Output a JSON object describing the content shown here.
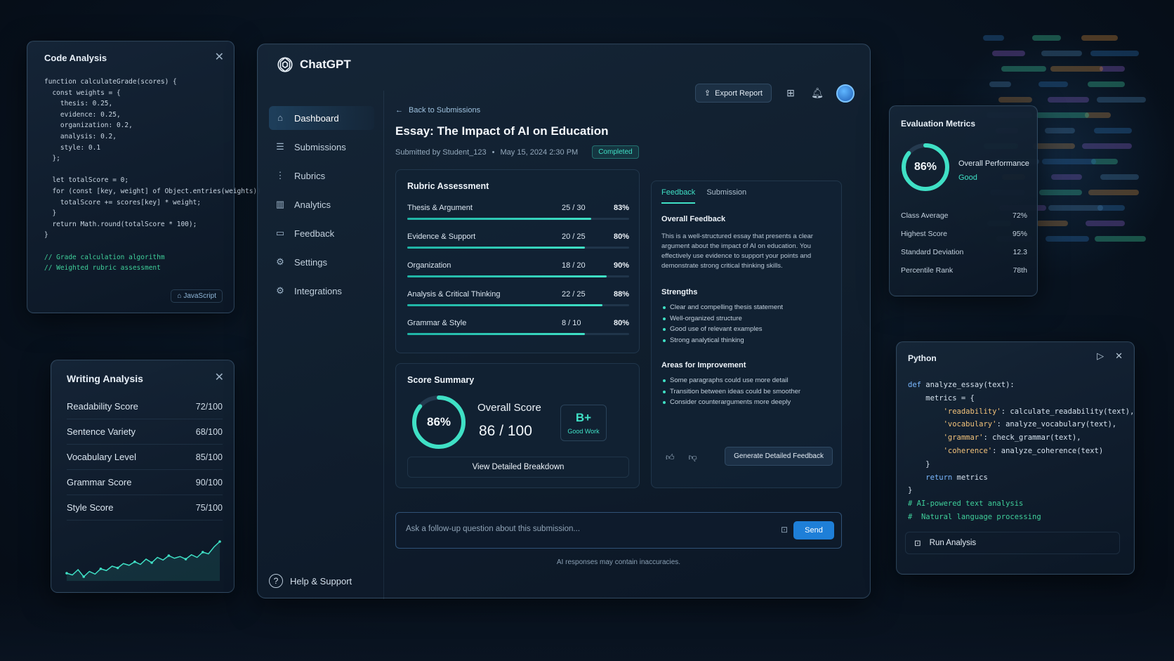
{
  "app": {
    "name": "ChatGPT"
  },
  "code_panel": {
    "title": "Code Analysis",
    "lines": [
      "function calculateGrade(scores) {",
      "  const weights = {",
      "    thesis: 0.25,",
      "    evidence: 0.25,",
      "    organization: 0.2,",
      "    analysis: 0.2,",
      "    style: 0.1",
      "  };",
      "",
      "  let totalScore = 0;",
      "  for (const [key, weight] of Object.entries(weights))",
      "    totalScore += scores[key] * weight;",
      "  }",
      "  return Math.round(totalScore * 100);",
      "}",
      "",
      "// Grade calculation algorithm",
      "// Weighted rubric assessment"
    ],
    "language": "JavaScript"
  },
  "writing_panel": {
    "title": "Writing Analysis",
    "rows": [
      {
        "label": "Readability Score",
        "value": "72/100"
      },
      {
        "label": "Sentence Variety",
        "value": "68/100"
      },
      {
        "label": "Vocabulary Level",
        "value": "85/100"
      },
      {
        "label": "Grammar Score",
        "value": "90/100"
      },
      {
        "label": "Style Score",
        "value": "75/100"
      }
    ],
    "trend": [
      22,
      20,
      26,
      18,
      24,
      21,
      27,
      25,
      30,
      28,
      33,
      31,
      35,
      32,
      38,
      34,
      40,
      37,
      42,
      39,
      41,
      38,
      43,
      40,
      46,
      44,
      52,
      58
    ]
  },
  "header": {
    "export_label": "Export Report"
  },
  "sidebar": {
    "items": [
      {
        "label": "Dashboard",
        "icon": "dashboard-icon",
        "active": true
      },
      {
        "label": "Submissions",
        "icon": "submissions-icon",
        "active": false
      },
      {
        "label": "Rubrics",
        "icon": "rubrics-icon",
        "active": false
      },
      {
        "label": "Analytics",
        "icon": "analytics-icon",
        "active": false
      },
      {
        "label": "Feedback",
        "icon": "feedback-icon",
        "active": false
      },
      {
        "label": "Settings",
        "icon": "gear-icon",
        "active": false
      },
      {
        "label": "Integrations",
        "icon": "integrations-icon",
        "active": false
      }
    ],
    "help_label": "Help & Support"
  },
  "essay": {
    "back_label": "Back to Submissions",
    "title": "Essay: The Impact of AI on Education",
    "submitted_by": "Submitted by Student_123",
    "date": "May 15, 2024 2:30 PM",
    "status": "Completed"
  },
  "rubric": {
    "title": "Rubric Assessment",
    "rows": [
      {
        "name": "Thesis & Argument",
        "score": "25 / 30",
        "pct": "83%",
        "fill": 0.83
      },
      {
        "name": "Evidence & Support",
        "score": "20 / 25",
        "pct": "80%",
        "fill": 0.8
      },
      {
        "name": "Organization",
        "score": "18 / 20",
        "pct": "90%",
        "fill": 0.9
      },
      {
        "name": "Analysis & Critical Thinking",
        "score": "22 / 25",
        "pct": "88%",
        "fill": 0.88
      },
      {
        "name": "Grammar & Style",
        "score": "8 / 10",
        "pct": "80%",
        "fill": 0.8
      }
    ]
  },
  "summary": {
    "title": "Score Summary",
    "ring_value": "86%",
    "ring_fraction": 0.86,
    "overall_label": "Overall Score",
    "overall_value": "86 / 100",
    "grade": "B+",
    "grade_note": "Good Work",
    "breakdown_label": "View Detailed Breakdown"
  },
  "feedback": {
    "tabs": [
      "Feedback",
      "Submission"
    ],
    "overall_title": "Overall Feedback",
    "overall_text": "This is a well-structured essay that presents a clear argument about the impact of AI on education. You effectively use evidence to support your points and demonstrate strong critical thinking skills.",
    "strengths_title": "Strengths",
    "strengths": [
      "Clear and compelling thesis statement",
      "Well-organized structure",
      "Good use of relevant examples",
      "Strong analytical thinking"
    ],
    "improve_title": "Areas for Improvement",
    "improvements": [
      "Some paragraphs could use more detail",
      "Transition between ideas could be smoother",
      "Consider counterarguments more deeply"
    ],
    "generate_label": "Generate Detailed Feedback"
  },
  "ask": {
    "placeholder": "Ask a follow-up question about this submission...",
    "send_label": "Send",
    "disclaimer": "AI responses may contain inaccuracies."
  },
  "metrics": {
    "title": "Evaluation Metrics",
    "ring_value": "86%",
    "ring_fraction": 0.86,
    "perf_label": "Overall Performance",
    "perf_value": "Good",
    "rows": [
      {
        "label": "Class Average",
        "value": "72%"
      },
      {
        "label": "Highest Score",
        "value": "95%"
      },
      {
        "label": "Standard Deviation",
        "value": "12.3"
      },
      {
        "label": "Percentile Rank",
        "value": "78th"
      }
    ]
  },
  "python": {
    "title": "Python",
    "run_label": "Run Analysis"
  },
  "colors": {
    "accent": "#3fe0c5",
    "primary": "#1e7fd8",
    "background": "#081320"
  }
}
